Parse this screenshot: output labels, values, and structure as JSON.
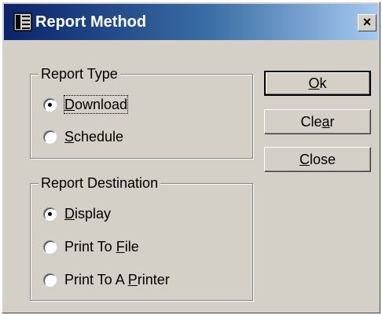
{
  "window": {
    "title": "Report Method",
    "close_glyph": "×"
  },
  "icons": {
    "app": "document-list-icon",
    "close": "close-icon"
  },
  "report_type": {
    "label": "Report Type",
    "options": [
      {
        "pre": "",
        "key": "D",
        "post": "ownload",
        "checked": true,
        "focused": true
      },
      {
        "pre": "",
        "key": "S",
        "post": "chedule",
        "checked": false,
        "focused": false
      }
    ]
  },
  "report_destination": {
    "label": "Report Destination",
    "options": [
      {
        "pre": "",
        "key": "D",
        "post": "isplay",
        "checked": true
      },
      {
        "pre": "Print To ",
        "key": "F",
        "post": "ile",
        "checked": false
      },
      {
        "pre": "Print To A ",
        "key": "P",
        "post": "rinter",
        "checked": false
      }
    ]
  },
  "buttons": {
    "ok": {
      "pre": "",
      "key": "O",
      "post": "k"
    },
    "clear": {
      "pre": "Cle",
      "key": "a",
      "post": "r"
    },
    "close": {
      "pre": "",
      "key": "C",
      "post": "lose"
    }
  },
  "colors": {
    "face": "#d4d0c8",
    "title_start": "#0a246a",
    "title_end": "#a6caf0"
  }
}
